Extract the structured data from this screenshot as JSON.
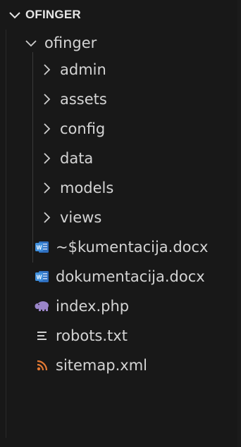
{
  "explorer": {
    "workspace_title": "OFINGER",
    "root_folder": "ofinger",
    "folders": [
      {
        "label": "admin"
      },
      {
        "label": "assets"
      },
      {
        "label": "config"
      },
      {
        "label": "data"
      },
      {
        "label": "models"
      },
      {
        "label": "views"
      }
    ],
    "files": [
      {
        "label": "~$kumentacija.docx",
        "icon": "word-doc-icon"
      },
      {
        "label": "dokumentacija.docx",
        "icon": "word-doc-icon"
      },
      {
        "label": "index.php",
        "icon": "php-elephant-icon"
      },
      {
        "label": "robots.txt",
        "icon": "text-lines-icon"
      },
      {
        "label": "sitemap.xml",
        "icon": "rss-icon"
      }
    ]
  },
  "colors": {
    "background": "#181818",
    "text": "#cccccc",
    "word_blue": "#3f8fdc",
    "php_purple": "#9b86c9",
    "rss_orange": "#e37933"
  }
}
